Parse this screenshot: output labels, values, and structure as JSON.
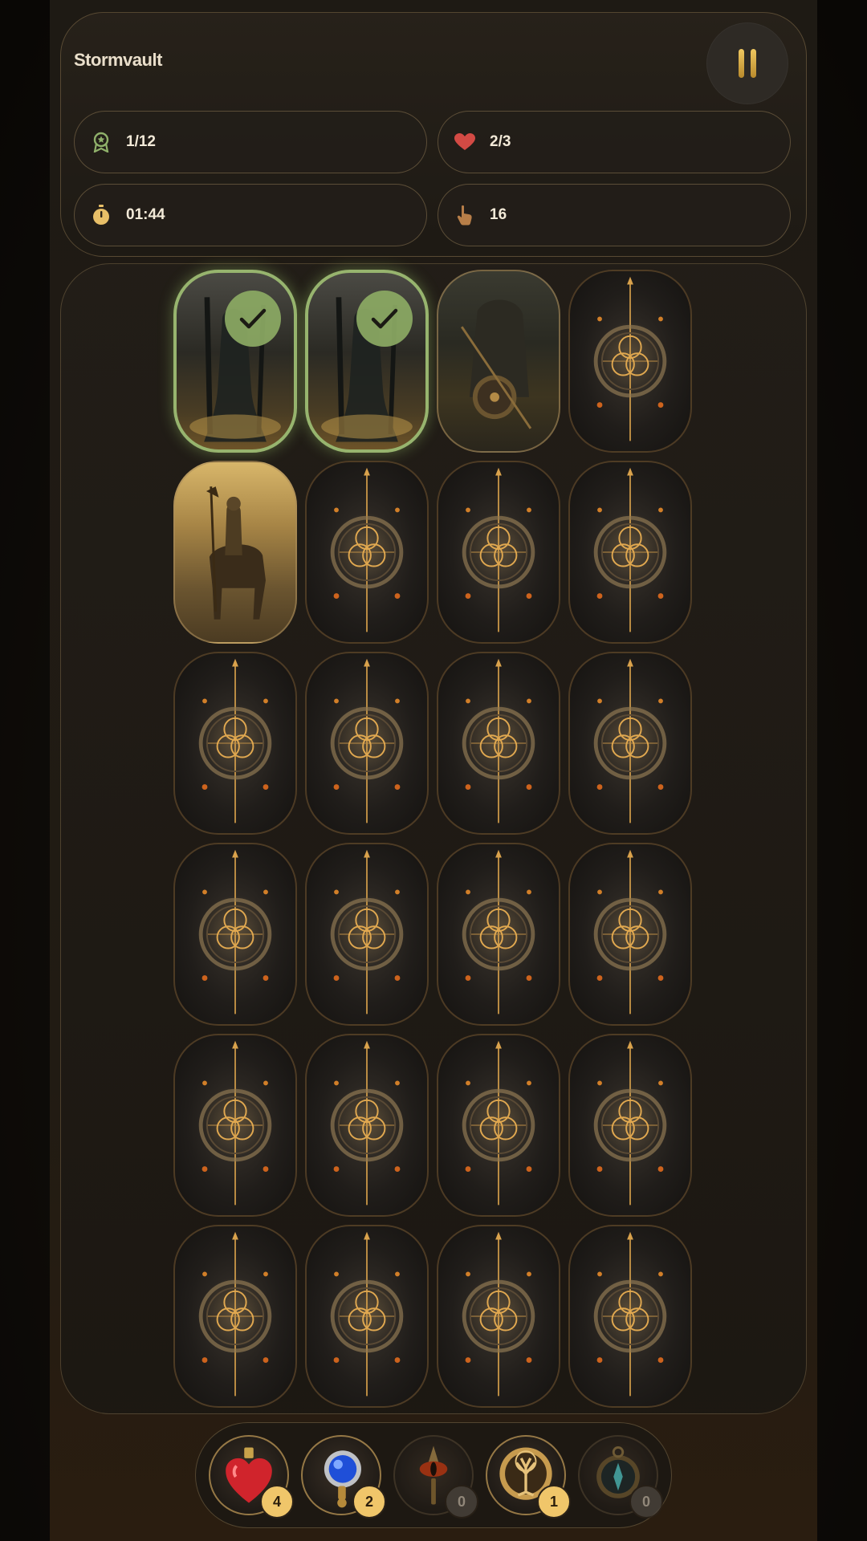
{
  "header": {
    "title": "Stormvault",
    "stats": {
      "pairs": "1/12",
      "lives": "2/3",
      "timer": "01:44",
      "moves": "16"
    }
  },
  "icons": {
    "pairs": "award-ribbon-icon",
    "lives": "heart-icon",
    "timer": "stopwatch-icon",
    "moves": "tap-finger-icon",
    "pause": "pause-icon"
  },
  "board": {
    "columns": 4,
    "rows": 6,
    "revealed_cards": [
      {
        "position": 1,
        "art": "hooded-wraith",
        "state": "matched"
      },
      {
        "position": 2,
        "art": "hooded-wraith",
        "state": "matched"
      },
      {
        "position": 3,
        "art": "armored-warrior-shield",
        "state": "revealed"
      },
      {
        "position": 5,
        "art": "mounted-knight",
        "state": "revealed"
      }
    ]
  },
  "powerups": [
    {
      "name": "heart-potion",
      "count": "4"
    },
    {
      "name": "sapphire-amulet",
      "count": "2"
    },
    {
      "name": "eye-wand",
      "count": "0"
    },
    {
      "name": "tree-medallion",
      "count": "1"
    },
    {
      "name": "compass",
      "count": "0"
    }
  ],
  "colors": {
    "accent_gold": "#f0c66a",
    "matched_green": "#97b46e",
    "heart_red": "#d34a44"
  }
}
